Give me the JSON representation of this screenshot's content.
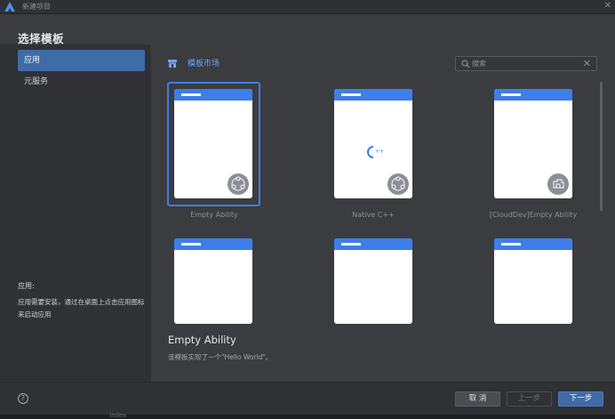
{
  "window": {
    "title": "新建项目"
  },
  "header": {
    "title": "选择模板"
  },
  "sidebar": {
    "items": [
      {
        "label": "应用",
        "active": true
      },
      {
        "label": "元服务",
        "active": false
      }
    ],
    "description_title": "应用:",
    "description": "应用需要安装，通过在桌面上点击应用图标来启动应用"
  },
  "main": {
    "market_label": "模板市场",
    "search": {
      "placeholder": "搜索",
      "value": ""
    },
    "templates": [
      {
        "label": "Empty Ability",
        "selected": true,
        "icon": "ability-icon"
      },
      {
        "label": "Native C++",
        "selected": false,
        "icon": "cpp-icon"
      },
      {
        "label": "[CloudDev]Empty Ability",
        "selected": false,
        "icon": "cloud-dev-icon"
      },
      {
        "label": "",
        "selected": false,
        "icon": ""
      },
      {
        "label": "",
        "selected": false,
        "icon": ""
      },
      {
        "label": "",
        "selected": false,
        "icon": ""
      }
    ],
    "detail": {
      "title": "Empty Ability",
      "description": "该模板实现了一个\"Hello World\"。"
    }
  },
  "footer": {
    "help_label": "?",
    "cancel_label": "取 消",
    "prev_label": "上一步",
    "next_label": "下一步"
  },
  "bottom_strip": {
    "tag": "Index"
  },
  "colors": {
    "accent": "#3d7eea",
    "selected_bg": "#3f6ba6",
    "link": "#6fa3ff"
  }
}
